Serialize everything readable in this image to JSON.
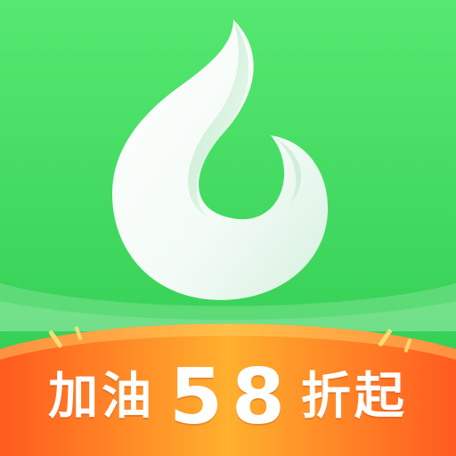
{
  "promo": {
    "prefix": "加油",
    "number": "58",
    "suffix": "折起"
  },
  "colors": {
    "background_top": "#56e870",
    "background_bottom": "#2cc94f",
    "flame": "#ffffff",
    "flame_shadow": "#cfeedd",
    "banner_light": "#ffb02e",
    "banner_dark": "#ff5a1f",
    "promo_text": "#ffffff"
  },
  "icons": {
    "logo": "flame-drop-icon"
  }
}
